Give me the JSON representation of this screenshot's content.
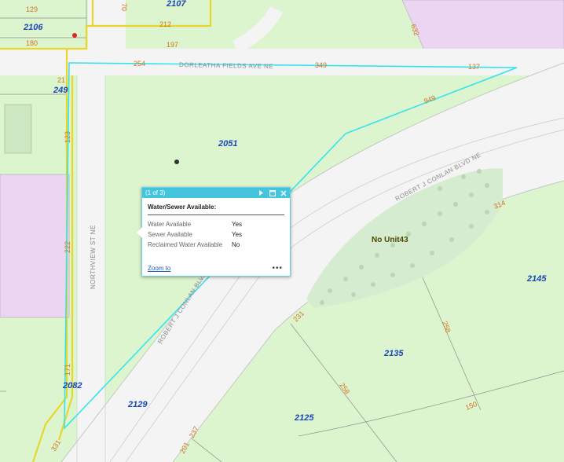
{
  "parcels": [
    "2107",
    "2106",
    "2051",
    "2145",
    "2135",
    "2129",
    "2125",
    "2082",
    "249"
  ],
  "dimensions": [
    "129",
    "180",
    "212",
    "197",
    "254",
    "349",
    "137",
    "949",
    "21",
    "123",
    "222",
    "171",
    "331",
    "231",
    "258",
    "258",
    "150",
    "237",
    "201",
    "314",
    "632",
    "70"
  ],
  "streets": {
    "dorleatha": "DORLEATHA FIELDS AVE NE",
    "northview": "NORTHVIEW ST NE",
    "conlan_upper": "ROBERT J CONLAN BLVD NE",
    "conlan_lower": "ROBERT J CONLAN BLVD NE"
  },
  "unit_label": "No Unit43",
  "popup": {
    "count": "(1 of 3)",
    "title": "Water/Sewer Available:",
    "rows": [
      {
        "label": "Water Available",
        "value": "Yes"
      },
      {
        "label": "Sewer Available",
        "value": "Yes"
      },
      {
        "label": "Reclaimed Water Available",
        "value": "No"
      }
    ],
    "zoom_label": "Zoom to",
    "more_label": "•••"
  }
}
